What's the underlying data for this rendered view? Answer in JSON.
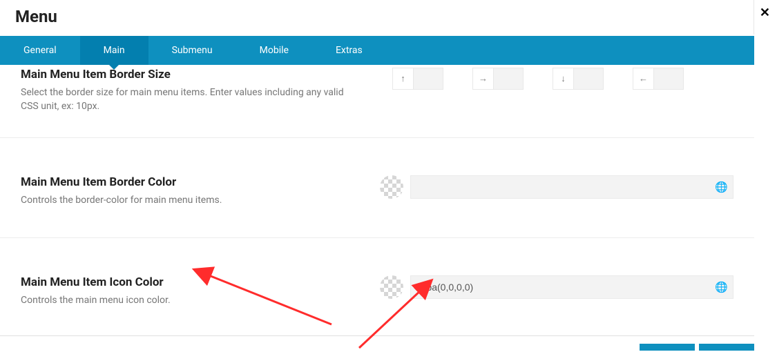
{
  "title": "Menu",
  "tabs": [
    {
      "label": "General"
    },
    {
      "label": "Main",
      "active": true
    },
    {
      "label": "Submenu"
    },
    {
      "label": "Mobile"
    },
    {
      "label": "Extras"
    }
  ],
  "rows": {
    "border_size": {
      "title": "Main Menu Item Border Size",
      "desc": "Select the border size for main menu items. Enter values including any valid CSS unit, ex: 10px.",
      "top": "",
      "right": "",
      "bottom": "",
      "left": ""
    },
    "border_color": {
      "title": "Main Menu Item Border Color",
      "desc": "Controls the border-color for main menu items.",
      "value": ""
    },
    "icon_color": {
      "title": "Main Menu Item Icon Color",
      "desc": "Controls the main menu icon color.",
      "value": "rgba(0,0,0,0)"
    }
  }
}
